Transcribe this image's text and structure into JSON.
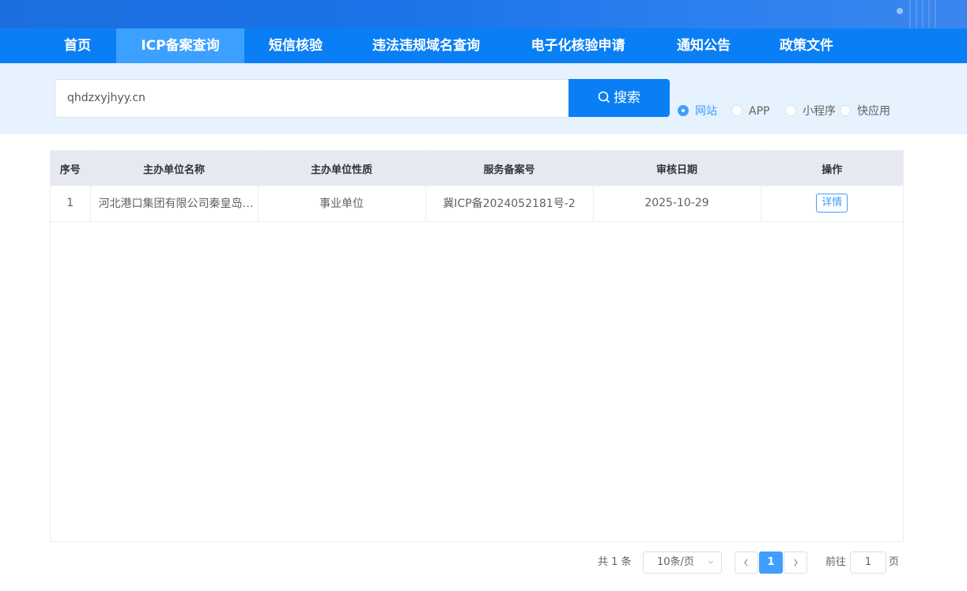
{
  "nav": {
    "items": [
      {
        "label": "首页"
      },
      {
        "label": "ICP备案查询"
      },
      {
        "label": "短信核验"
      },
      {
        "label": "违法违规域名查询"
      },
      {
        "label": "电子化核验申请"
      },
      {
        "label": "通知公告"
      },
      {
        "label": "政策文件"
      }
    ],
    "active_index": 1
  },
  "search": {
    "value": "qhdzxyjhyy.cn",
    "button_label": "搜索",
    "icon": "search-icon"
  },
  "types": {
    "options": [
      {
        "label": "网站",
        "checked": true
      },
      {
        "label": "APP",
        "checked": false
      },
      {
        "label": "小程序",
        "checked": false
      },
      {
        "label": "快应用",
        "checked": false
      }
    ]
  },
  "table": {
    "headers": [
      "序号",
      "主办单位名称",
      "主办单位性质",
      "服务备案号",
      "审核日期",
      "操作"
    ],
    "rows": [
      {
        "index": "1",
        "org_name": "河北港口集团有限公司秦皇岛中心医院",
        "org_type": "事业单位",
        "license": "冀ICP备2024052181号-2",
        "date": "2025-10-29",
        "action": "详情"
      }
    ]
  },
  "pagination": {
    "total_text": "共 1 条",
    "page_size": "10条/页",
    "current_page": "1",
    "goto_prefix": "前往",
    "goto_value": "1",
    "goto_suffix": "页"
  },
  "colors": {
    "nav_bg": "#0a7ff5",
    "nav_active": "#3ba0ff",
    "accent": "#409eff"
  }
}
